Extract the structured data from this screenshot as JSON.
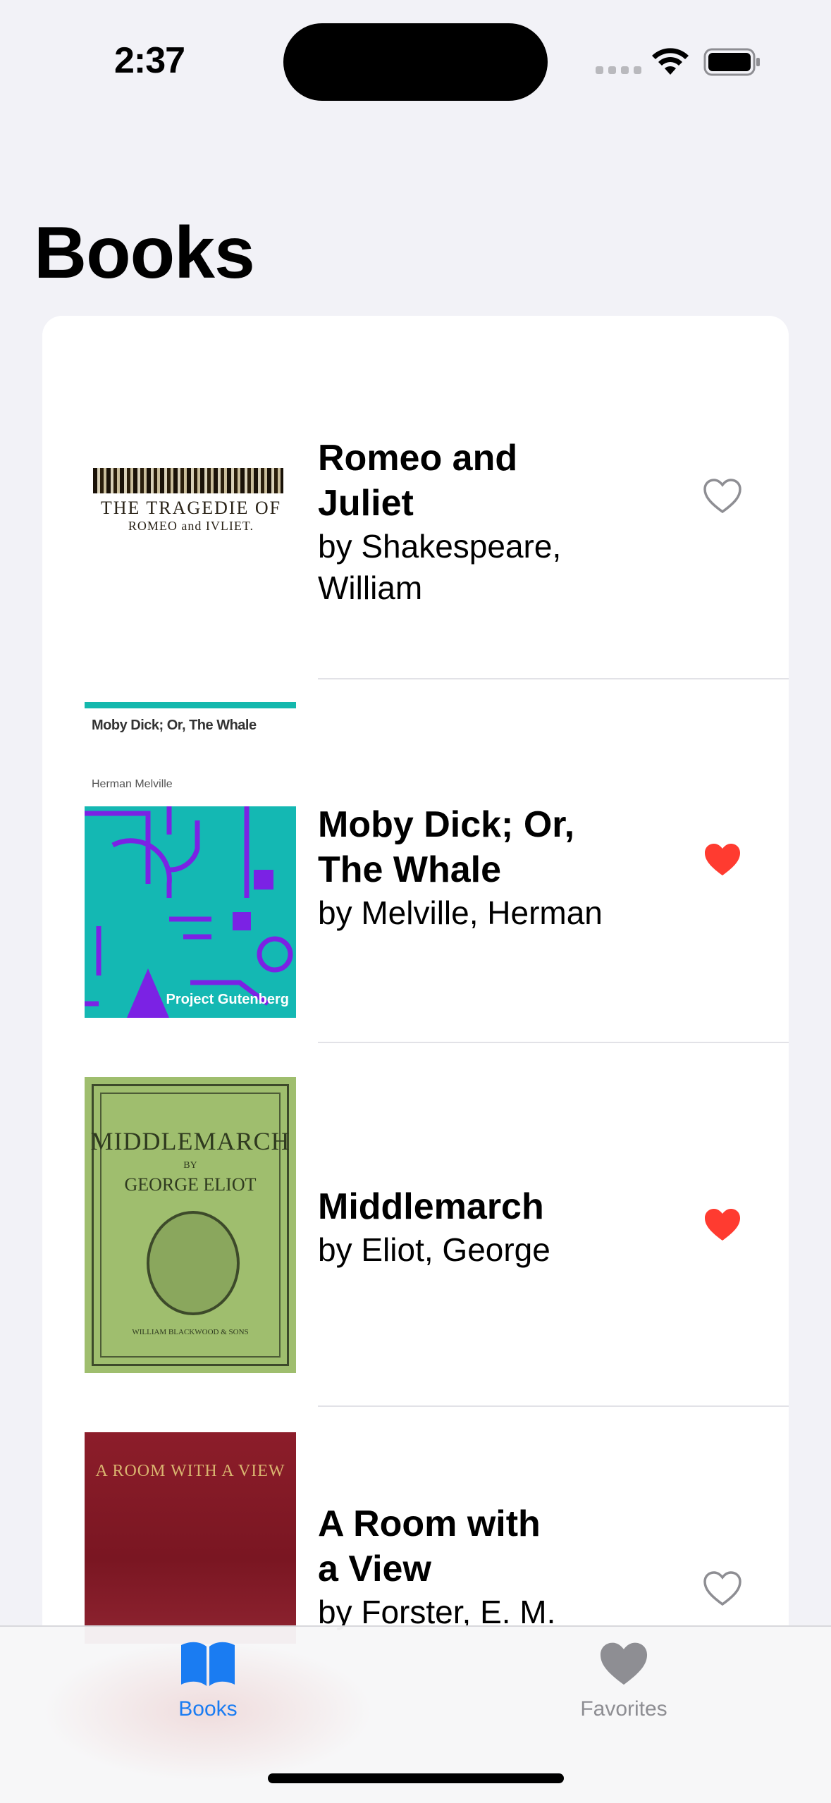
{
  "status_bar": {
    "time": "2:37"
  },
  "page": {
    "title": "Books"
  },
  "books": [
    {
      "title_lines": [
        "Romeo and Juliet"
      ],
      "author_lines": [
        "by Shakespeare,",
        "William"
      ],
      "favorite": false,
      "cover": {
        "line1": "THE TRAGEDIE OF",
        "line2": "ROMEO and IVLIET."
      }
    },
    {
      "title_lines": [
        "Moby Dick; Or,",
        "The Whale"
      ],
      "author_lines": [
        "by Melville, Herman"
      ],
      "favorite": true,
      "cover": {
        "title": "Moby Dick; Or, The Whale",
        "author": "Herman Melville",
        "publisher": "Project Gutenberg"
      }
    },
    {
      "title_lines": [
        "Middlemarch"
      ],
      "author_lines": [
        "by Eliot, George"
      ],
      "favorite": true,
      "cover": {
        "title": "MIDDLEMARCH",
        "by": "BY",
        "author": "GEORGE ELIOT",
        "publisher": "WILLIAM BLACKWOOD & SONS"
      }
    },
    {
      "title_lines": [
        "A Room with",
        "a View"
      ],
      "author_lines": [
        "by Forster, E. M."
      ],
      "favorite": false,
      "cover": {
        "title": "A ROOM WITH A VIEW"
      }
    }
  ],
  "tabbar": {
    "tabs": [
      {
        "label": "Books",
        "icon": "book-icon",
        "selected": true
      },
      {
        "label": "Favorites",
        "icon": "heart-icon",
        "selected": false
      }
    ]
  },
  "colors": {
    "accent": "#1a7cf2",
    "favorite": "#ff3b30",
    "inactive": "#8e8e93"
  }
}
